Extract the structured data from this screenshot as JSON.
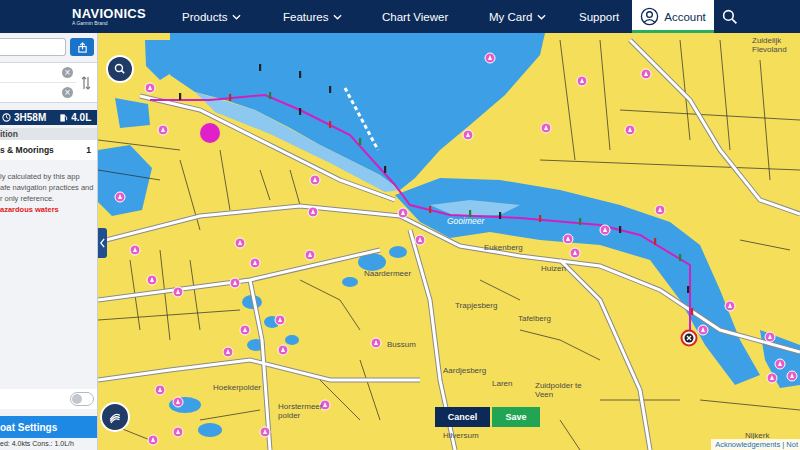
{
  "header": {
    "logo": "NAVIONICS",
    "tagline": "A Garmin Brand",
    "nav": [
      {
        "label": "Products",
        "kind": "menu",
        "selected": false
      },
      {
        "label": "Features",
        "kind": "menu",
        "selected": false
      },
      {
        "label": "Chart Viewer",
        "kind": "link",
        "selected": false
      },
      {
        "label": "My Card",
        "kind": "menu",
        "selected": false
      },
      {
        "label": "Support",
        "kind": "link",
        "selected": false
      },
      {
        "label": "Account",
        "kind": "account",
        "selected": true
      }
    ]
  },
  "sidebar": {
    "route_fields": [
      {
        "clear": "×"
      },
      {
        "clear": "×"
      }
    ],
    "stats": {
      "duration": "3H58M",
      "fuel": "4.0L"
    },
    "section": "ition",
    "items": [
      {
        "label": "s & Moorings",
        "count": "1"
      }
    ],
    "notice": [
      "ly calculated by this app",
      "afe navigation practices and",
      "r only reference."
    ],
    "warning": "azardous waters",
    "toggle": {
      "on": false
    },
    "settings_button": "oat Settings",
    "footer": "ed: 4.0kts Cons.: 1.0L/h"
  },
  "map": {
    "labels": [
      {
        "text": "Zuidelijk Flevoland",
        "kind": "land"
      },
      {
        "text": "Gooimeer",
        "kind": "water"
      },
      {
        "text": "Eukenberg",
        "kind": "land"
      },
      {
        "text": "Huizen",
        "kind": "land"
      },
      {
        "text": "Naardermeer",
        "kind": "land"
      },
      {
        "text": "Trapjesberg",
        "kind": "land"
      },
      {
        "text": "Tafelberg",
        "kind": "land"
      },
      {
        "text": "Bussum",
        "kind": "land"
      },
      {
        "text": "Aardjesberg",
        "kind": "land"
      },
      {
        "text": "Laren",
        "kind": "land"
      },
      {
        "text": "Zuidpolder te Veen",
        "kind": "land"
      },
      {
        "text": "Hoekerpolder",
        "kind": "land"
      },
      {
        "text": "Horstermeer polder",
        "kind": "land"
      },
      {
        "text": "Hilversum",
        "kind": "land"
      },
      {
        "text": "Nijkerk",
        "kind": "land"
      }
    ],
    "actions": [
      {
        "label": "Cancel",
        "kind": "secondary"
      },
      {
        "label": "Save",
        "kind": "primary"
      }
    ],
    "attribution": "Acknowledgements | Not"
  }
}
